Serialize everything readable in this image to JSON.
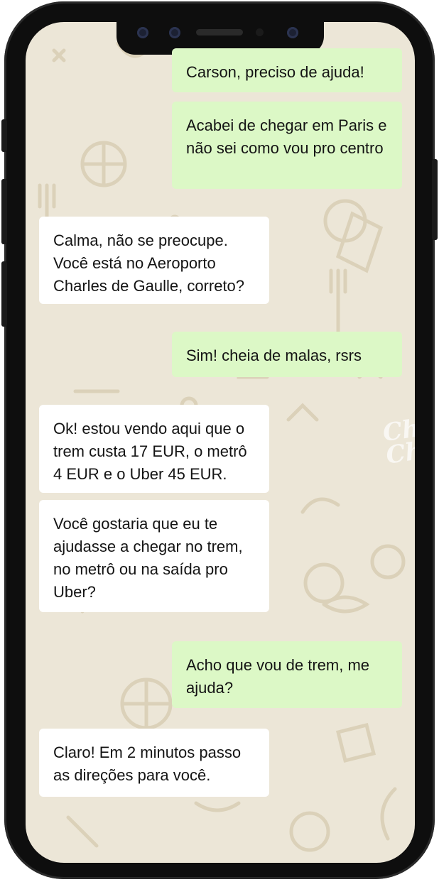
{
  "chat": {
    "messages": [
      {
        "side": "sent",
        "text": "Carson, preciso de ajuda!"
      },
      {
        "side": "sent",
        "text": "Acabei de chegar em Paris e não sei como vou pro centro"
      },
      {
        "side": "received",
        "text": "Calma, não se preocupe. Você está no Aeroporto Charles de Gaulle, correto?"
      },
      {
        "side": "sent",
        "text": "Sim! cheia de malas, rsrs"
      },
      {
        "side": "received",
        "text": "Ok! estou vendo aqui que o trem custa 17 EUR, o metrô 4 EUR e o Uber 45 EUR."
      },
      {
        "side": "received",
        "text": "Você gostaria que eu te ajudasse a chegar no trem, no metrô ou na saída pro Uber?"
      },
      {
        "side": "sent",
        "text": "Acho que vou de trem, me ajuda?"
      },
      {
        "side": "received",
        "text": "Claro! Em 2 minutos passo as direções para você."
      }
    ]
  },
  "background": {
    "watermark": "Chat Child",
    "color": "#ece6d7",
    "doodle_color": "#ddd3bb"
  },
  "colors": {
    "sent_bubble": "#dcf8c6",
    "received_bubble": "#ffffff",
    "phone_frame": "#0e0e0e"
  }
}
